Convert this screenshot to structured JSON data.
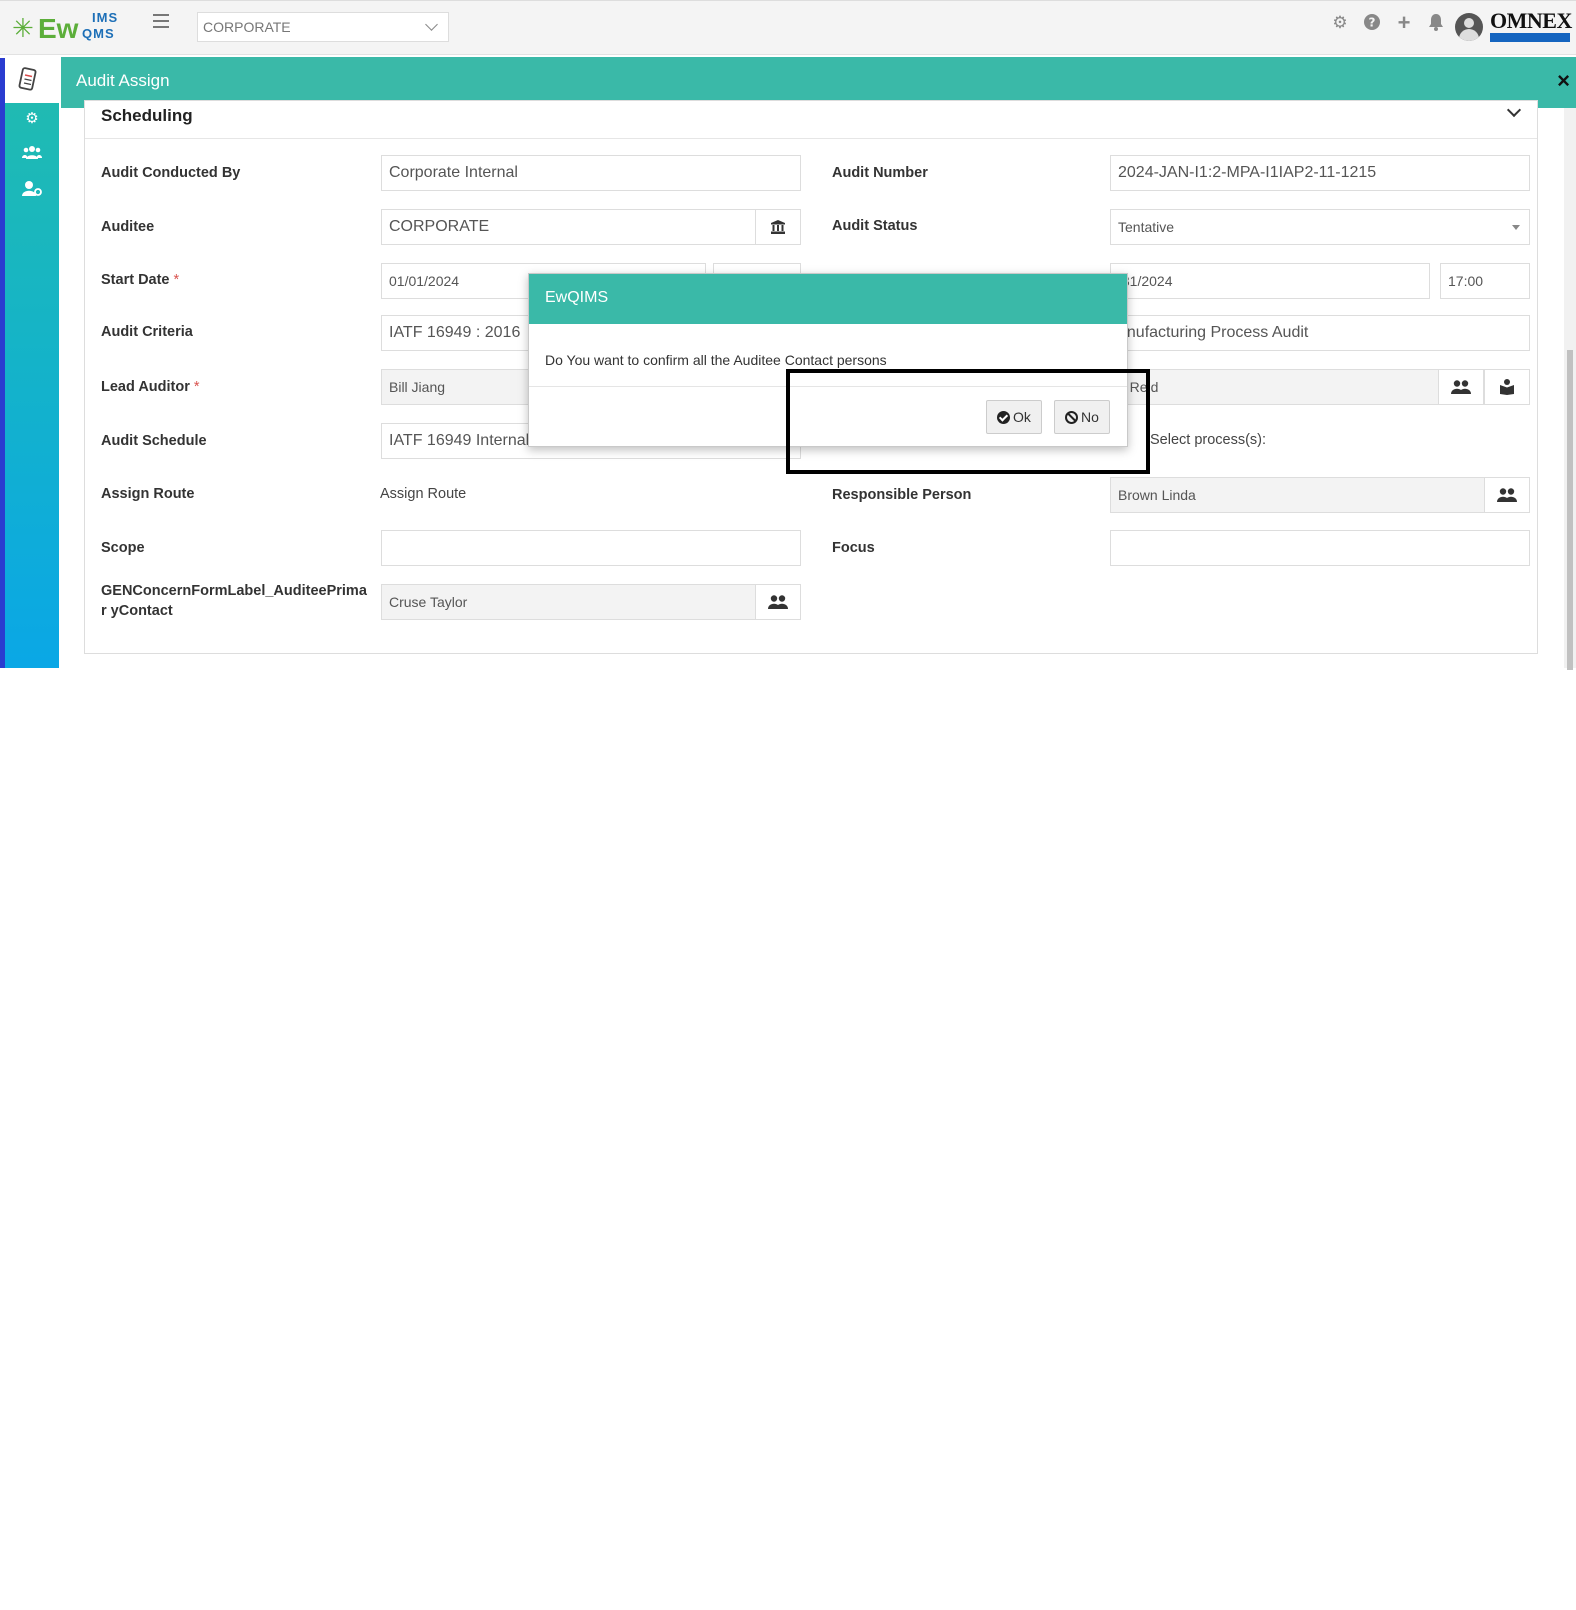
{
  "app": {
    "logo_main": "Ew",
    "logo_ims": "IMS",
    "logo_qms": "QMS",
    "org_selector": "CORPORATE",
    "brand": "OMNEX",
    "icons": [
      "gear-icon",
      "help-icon",
      "plus-icon",
      "bell-icon",
      "avatar",
      "omnex-logo"
    ]
  },
  "sidebar": {
    "items": [
      "audit-icon",
      "settings-icon",
      "group-icon",
      "user-settings-icon"
    ]
  },
  "page": {
    "title": "Audit Assign",
    "close": "×"
  },
  "section": {
    "title": "Scheduling"
  },
  "form": {
    "audit_conducted_by_label": "Audit Conducted By",
    "audit_conducted_by": "Corporate Internal",
    "audit_number_label": "Audit Number",
    "audit_number": "2024-JAN-I1:2-MPA-I1IAP2-11-1215",
    "auditee_label": "Auditee",
    "auditee": "CORPORATE",
    "audit_status_label": "Audit Status",
    "audit_status": "Tentative",
    "start_date_label": "Start Date",
    "start_date": "01/01/2024",
    "end_date": "/31/2024",
    "end_time": "17:00",
    "audit_criteria_label": "Audit Criteria",
    "audit_criteria": "IATF 16949 : 2016",
    "audit_type": "anufacturing Process Audit",
    "lead_auditor_label": "Lead Auditor",
    "lead_auditor": "Bill  Jiang",
    "auditor_partial": "n  Reid",
    "audit_schedule_label": "Audit Schedule",
    "audit_schedule": "IATF 16949 Internal",
    "select_process": "Select process(s):",
    "assign_route_label": "Assign Route",
    "assign_route": "Assign Route",
    "responsible_person_label": "Responsible Person",
    "responsible_person": "Brown Linda",
    "scope_label": "Scope",
    "scope": "",
    "focus_label": "Focus",
    "focus": "",
    "primary_contact_label": "GENConcernFormLabel_AuditeePrimar yContact",
    "primary_contact": "Cruse Taylor",
    "required_mark": "*"
  },
  "dialog": {
    "title": "EwQIMS",
    "message": "Do You want to confirm all the Auditee Contact persons",
    "ok": "Ok",
    "no": "No"
  },
  "colors": {
    "teal": "#3ab9a8",
    "sidebar_top": "#22bcae",
    "sidebar_bottom": "#0aa7e6",
    "required": "#d9534f"
  }
}
